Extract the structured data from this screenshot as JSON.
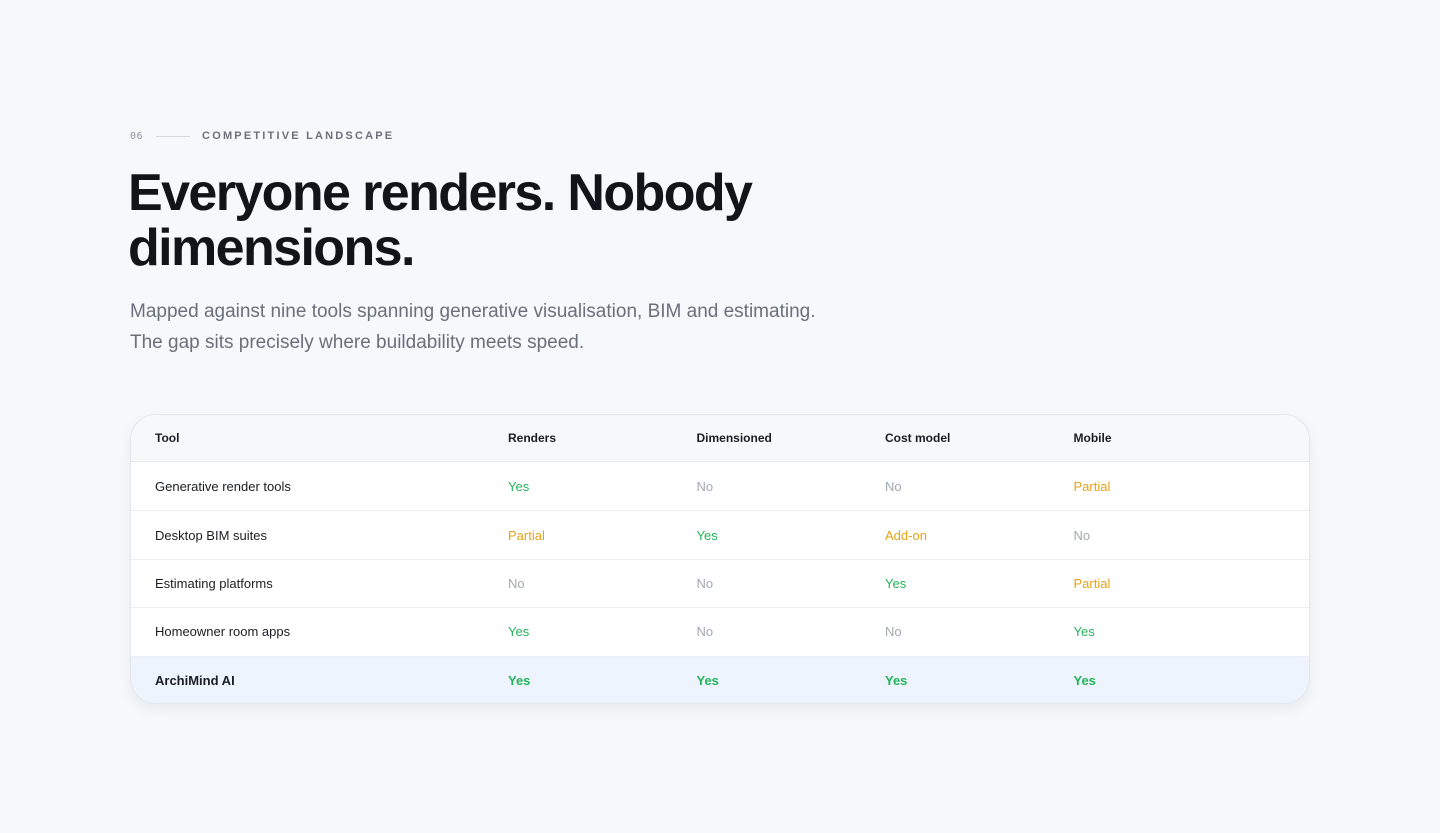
{
  "section": {
    "number": "06",
    "label": "COMPETITIVE LANDSCAPE"
  },
  "headline": {
    "line1": "Everyone renders. Nobody",
    "line2": "dimensions."
  },
  "subtitle": {
    "line1": "Mapped against nine tools spanning generative visualisation, BIM and estimating.",
    "line2": "The gap sits precisely where buildability meets speed."
  },
  "table": {
    "columns": [
      "Tool",
      "Renders",
      "Dimensioned",
      "Cost model",
      "Mobile"
    ],
    "rows": [
      {
        "tool": "Generative render tools",
        "renders": "Yes",
        "dimensioned": "No",
        "cost_model": "No",
        "mobile": "Partial"
      },
      {
        "tool": "Desktop BIM suites",
        "renders": "Partial",
        "dimensioned": "Yes",
        "cost_model": "Add-on",
        "mobile": "No"
      },
      {
        "tool": "Estimating platforms",
        "renders": "No",
        "dimensioned": "No",
        "cost_model": "Yes",
        "mobile": "Partial"
      },
      {
        "tool": "Homeowner room apps",
        "renders": "Yes",
        "dimensioned": "No",
        "cost_model": "No",
        "mobile": "Yes"
      },
      {
        "tool": "ArchiMind AI",
        "renders": "Yes",
        "dimensioned": "Yes",
        "cost_model": "Yes",
        "mobile": "Yes"
      }
    ]
  },
  "colors": {
    "yes": "#25b35a",
    "no": "#a3a8b0",
    "partial": "#e7a318",
    "highlight_row": "#edf4fd"
  }
}
